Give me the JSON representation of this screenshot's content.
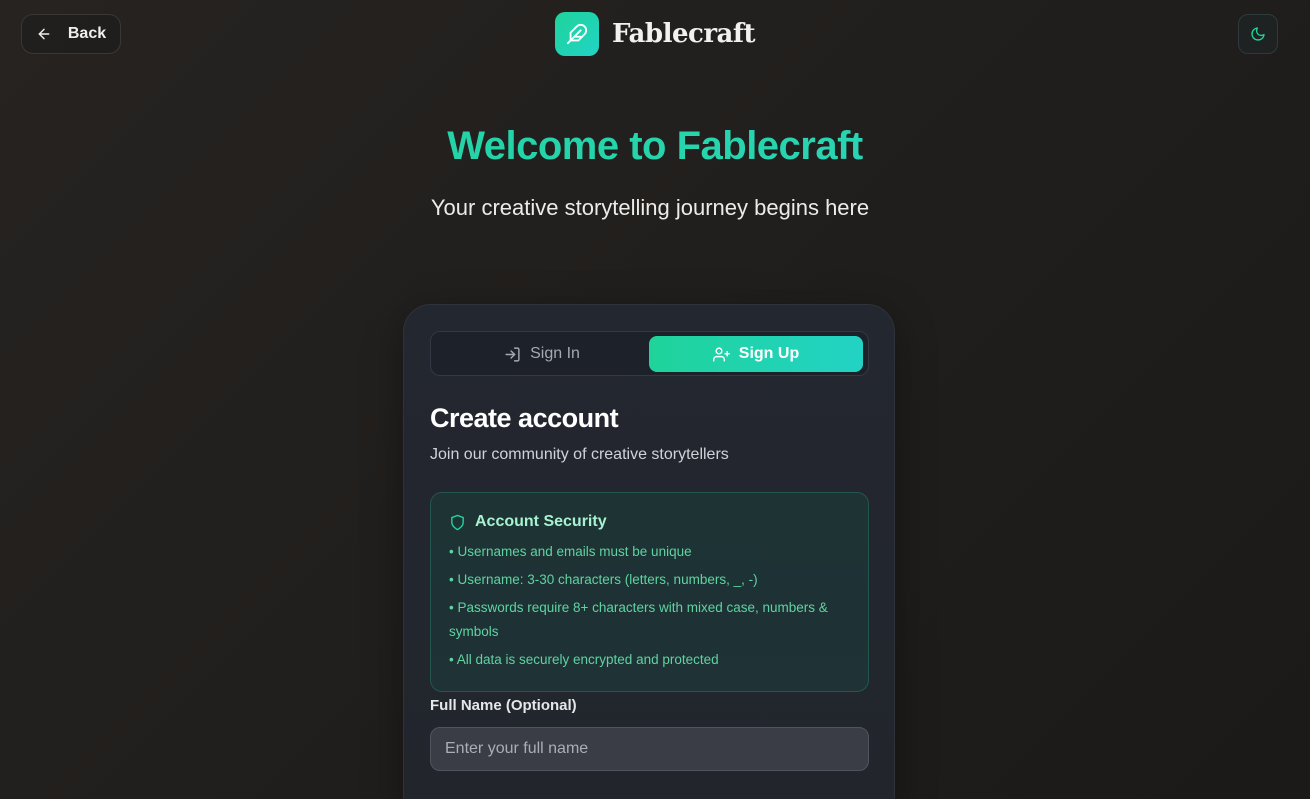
{
  "header": {
    "back_label": "Back",
    "brand_name": "Fablecraft"
  },
  "hero": {
    "title": "Welcome to Fablecraft",
    "subtitle": "Your creative storytelling journey begins here"
  },
  "auth": {
    "tabs": [
      {
        "label": "Sign In",
        "icon": "login-icon",
        "active": false
      },
      {
        "label": "Sign Up",
        "icon": "user-plus-icon",
        "active": true
      }
    ],
    "title": "Create account",
    "subtitle": "Join our community of creative storytellers",
    "security": {
      "title": "Account Security",
      "items": [
        "• Usernames and emails must be unique",
        "• Username: 3-30 characters (letters, numbers, _, -)",
        "• Passwords require 8+ characters with mixed case, numbers & symbols",
        "• All data is securely encrypted and protected"
      ]
    },
    "full_name": {
      "label": "Full Name (Optional)",
      "value": "",
      "placeholder": "Enter your full name"
    }
  },
  "colors": {
    "accent": "#1fd39a",
    "accent_end": "#22d3c5",
    "background": "#23211f"
  }
}
